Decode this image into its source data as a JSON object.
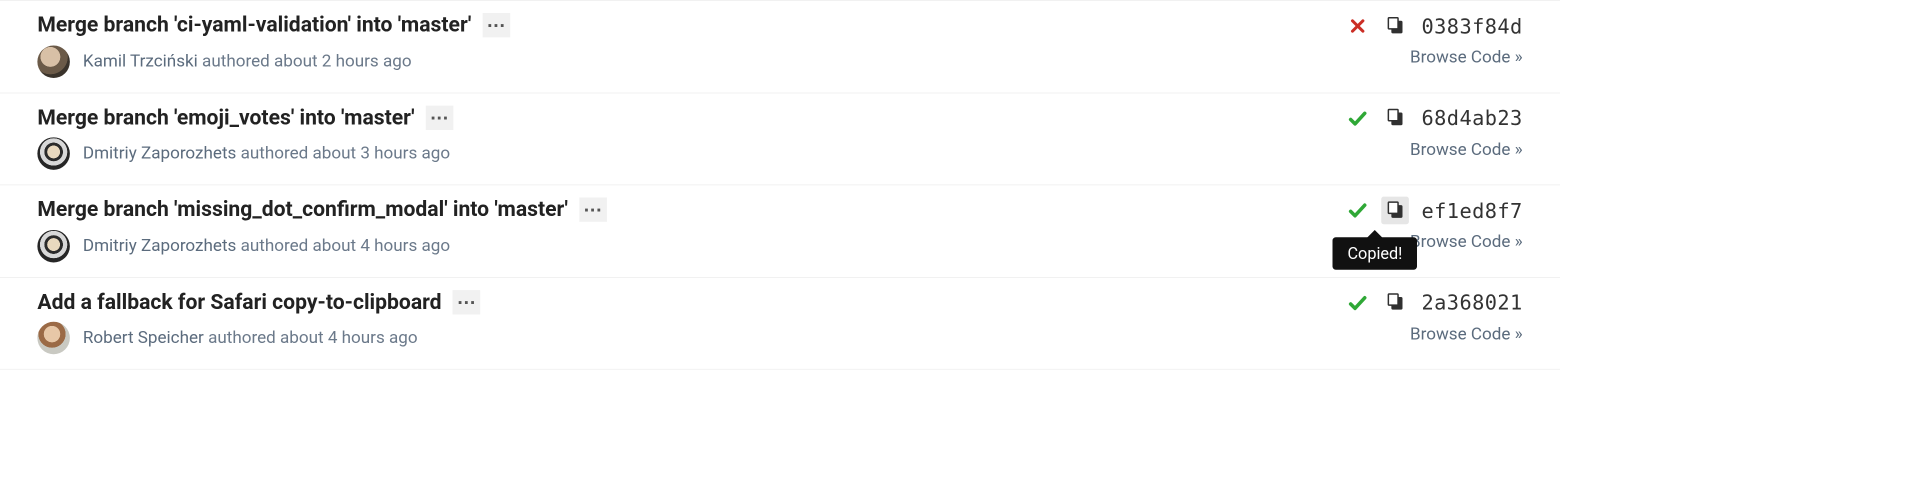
{
  "browse_label": "Browse Code »",
  "tooltip_text": "Copied!",
  "commits": [
    {
      "title": "Merge branch 'ci-yaml-validation' into 'master'",
      "author": "Kamil Trzciński",
      "meta": "authored about 2 hours ago",
      "hash": "0383f84d",
      "status": "fail",
      "avatar_class": "av0",
      "copy_active": false,
      "show_tooltip": false
    },
    {
      "title": "Merge branch 'emoji_votes' into 'master'",
      "author": "Dmitriy Zaporozhets",
      "meta": "authored about 3 hours ago",
      "hash": "68d4ab23",
      "status": "pass",
      "avatar_class": "av1",
      "copy_active": false,
      "show_tooltip": false
    },
    {
      "title": "Merge branch 'missing_dot_confirm_modal' into 'master'",
      "author": "Dmitriy Zaporozhets",
      "meta": "authored about 4 hours ago",
      "hash": "ef1ed8f7",
      "status": "pass",
      "avatar_class": "av1",
      "copy_active": true,
      "show_tooltip": true
    },
    {
      "title": "Add a fallback for Safari copy-to-clipboard",
      "author": "Robert Speicher",
      "meta": "authored about 4 hours ago",
      "hash": "2a368021",
      "status": "pass",
      "avatar_class": "av2",
      "copy_active": false,
      "show_tooltip": false
    }
  ]
}
